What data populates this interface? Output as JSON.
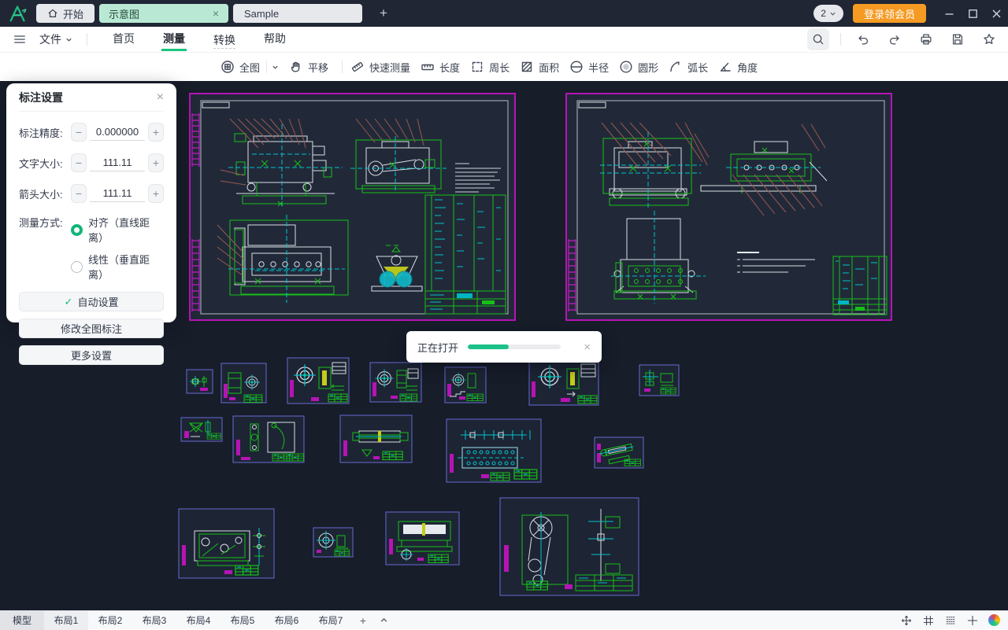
{
  "titlebar": {
    "tabs": [
      {
        "label": "开始"
      },
      {
        "label": "示意图",
        "active": true,
        "closable": true
      },
      {
        "label": "Sample"
      }
    ],
    "user_badge": "2",
    "login_button": "登录领会员"
  },
  "menubar": {
    "file": "文件",
    "items": [
      {
        "label": "首页"
      },
      {
        "label": "测量",
        "active": true
      },
      {
        "label": "转换"
      },
      {
        "label": "帮助"
      }
    ]
  },
  "toolbar": {
    "tools": [
      {
        "label": "全图",
        "icon": "fit-view",
        "dropdown": true
      },
      {
        "label": "平移",
        "icon": "pan-hand"
      },
      {
        "label": "快速测量",
        "icon": "quick-measure"
      },
      {
        "label": "长度",
        "icon": "length"
      },
      {
        "label": "周长",
        "icon": "perimeter"
      },
      {
        "label": "面积",
        "icon": "area"
      },
      {
        "label": "半径",
        "icon": "radius"
      },
      {
        "label": "圆形",
        "icon": "circle"
      },
      {
        "label": "弧长",
        "icon": "arc-length"
      },
      {
        "label": "角度",
        "icon": "angle"
      }
    ]
  },
  "panel": {
    "title": "标注设置",
    "fields": [
      {
        "label": "标注精度:",
        "value": "0.000000"
      },
      {
        "label": "文字大小:",
        "value": "111.11"
      },
      {
        "label": "箭头大小:",
        "value": "111.11"
      }
    ],
    "measure_mode_label": "测量方式:",
    "options": [
      {
        "label": "对齐（直线距离）",
        "selected": true
      },
      {
        "label": "线性（垂直距离）",
        "selected": false
      }
    ],
    "buttons": [
      {
        "label": "自动设置",
        "icon": "check"
      },
      {
        "label": "修改全图标注"
      },
      {
        "label": "更多设置"
      }
    ]
  },
  "dialog": {
    "text": "正在打开",
    "progress_percent": 44
  },
  "bottombar": {
    "tabs": [
      {
        "label": "模型",
        "state": "active"
      },
      {
        "label": "布局1",
        "state": "highlight"
      },
      {
        "label": "布局2"
      },
      {
        "label": "布局3"
      },
      {
        "label": "布局4"
      },
      {
        "label": "布局5"
      },
      {
        "label": "布局6"
      },
      {
        "label": "布局7"
      }
    ]
  },
  "glyphs": {
    "plus": "+",
    "close": "×",
    "minus": "−",
    "plus_step": "+",
    "check": "✓"
  },
  "colors": {
    "accent_green": "#19c57f",
    "brand_orange": "#f59a23",
    "mint_tab": "#b9e9d4",
    "canvas_bg": "#171d29",
    "cad_green": "#17c017",
    "cad_cyan": "#00c4cc",
    "cad_magenta": "#c21dc2",
    "cad_leader_brown": "#99594e",
    "sheet_border": "#b614b6"
  }
}
